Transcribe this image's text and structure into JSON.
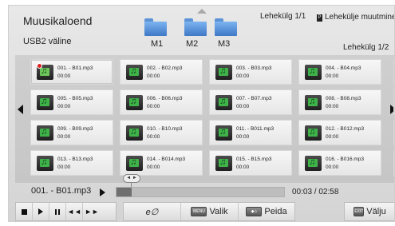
{
  "header": {
    "title": "Muusikaloend",
    "source": "USB2 väline",
    "folders": [
      "M1",
      "M2",
      "M3"
    ],
    "page_top": "Lehekülg 1/1",
    "page_move_badge": "P",
    "page_move_label": "Lehekülje muutmine",
    "page_right": "Lehekülg 1/2"
  },
  "files": [
    {
      "name": "001. - B01.mp3",
      "duration": "00:00",
      "playing": true
    },
    {
      "name": "002. - B02.mp3",
      "duration": "00:00"
    },
    {
      "name": "003. - B03.mp3",
      "duration": "00:00"
    },
    {
      "name": "004. - B04.mp3",
      "duration": "00:00"
    },
    {
      "name": "005. - B05.mp3",
      "duration": "00:00"
    },
    {
      "name": "006. - B06.mp3",
      "duration": "00:00"
    },
    {
      "name": "007. - B07.mp3",
      "duration": "00:00"
    },
    {
      "name": "008. - B08.mp3",
      "duration": "00:00"
    },
    {
      "name": "009. - B09.mp3",
      "duration": "00:00"
    },
    {
      "name": "010. - B10.mp3",
      "duration": "00:00"
    },
    {
      "name": "011. - B011.mp3",
      "duration": "00:00"
    },
    {
      "name": "012. - B012.mp3",
      "duration": "00:00"
    },
    {
      "name": "013. - B13.mp3",
      "duration": "00:00"
    },
    {
      "name": "014. - B014.mp3",
      "duration": "00:00"
    },
    {
      "name": "015. - B15.mp3",
      "duration": "00:00"
    },
    {
      "name": "016. - B016.mp3",
      "duration": "00:00"
    }
  ],
  "player": {
    "now_playing": "001. - B01.mp3",
    "progress_fraction": 0.09,
    "seek_hint": "◄ ►",
    "time": "00:03 / 02:58"
  },
  "controls": {
    "mode_label": "e∅",
    "menu_key": "MENU",
    "select_label": "Valik",
    "hide_label": "Peida",
    "exit_key": "EXIT",
    "exit_label": "Välju"
  }
}
